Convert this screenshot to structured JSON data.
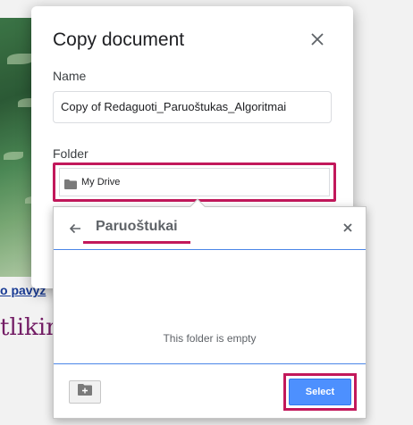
{
  "background": {
    "link_text": "o pavyz",
    "heading_text": "tlikin"
  },
  "dialog": {
    "title": "Copy document",
    "name_label": "Name",
    "name_value": "Copy of Redaguoti_Paruoštukas_Algoritmai",
    "folder_label": "Folder",
    "folder_value": "My Drive",
    "close_icon": "close-icon"
  },
  "picker": {
    "title": "Paruoštukai",
    "empty_message": "This folder is empty",
    "select_label": "Select",
    "icons": [
      "back-arrow-icon",
      "close-icon",
      "new-folder-icon"
    ]
  },
  "colors": {
    "highlight": "#c2185b",
    "select_button": "#4d90fe",
    "divider": "#4a86e8"
  }
}
